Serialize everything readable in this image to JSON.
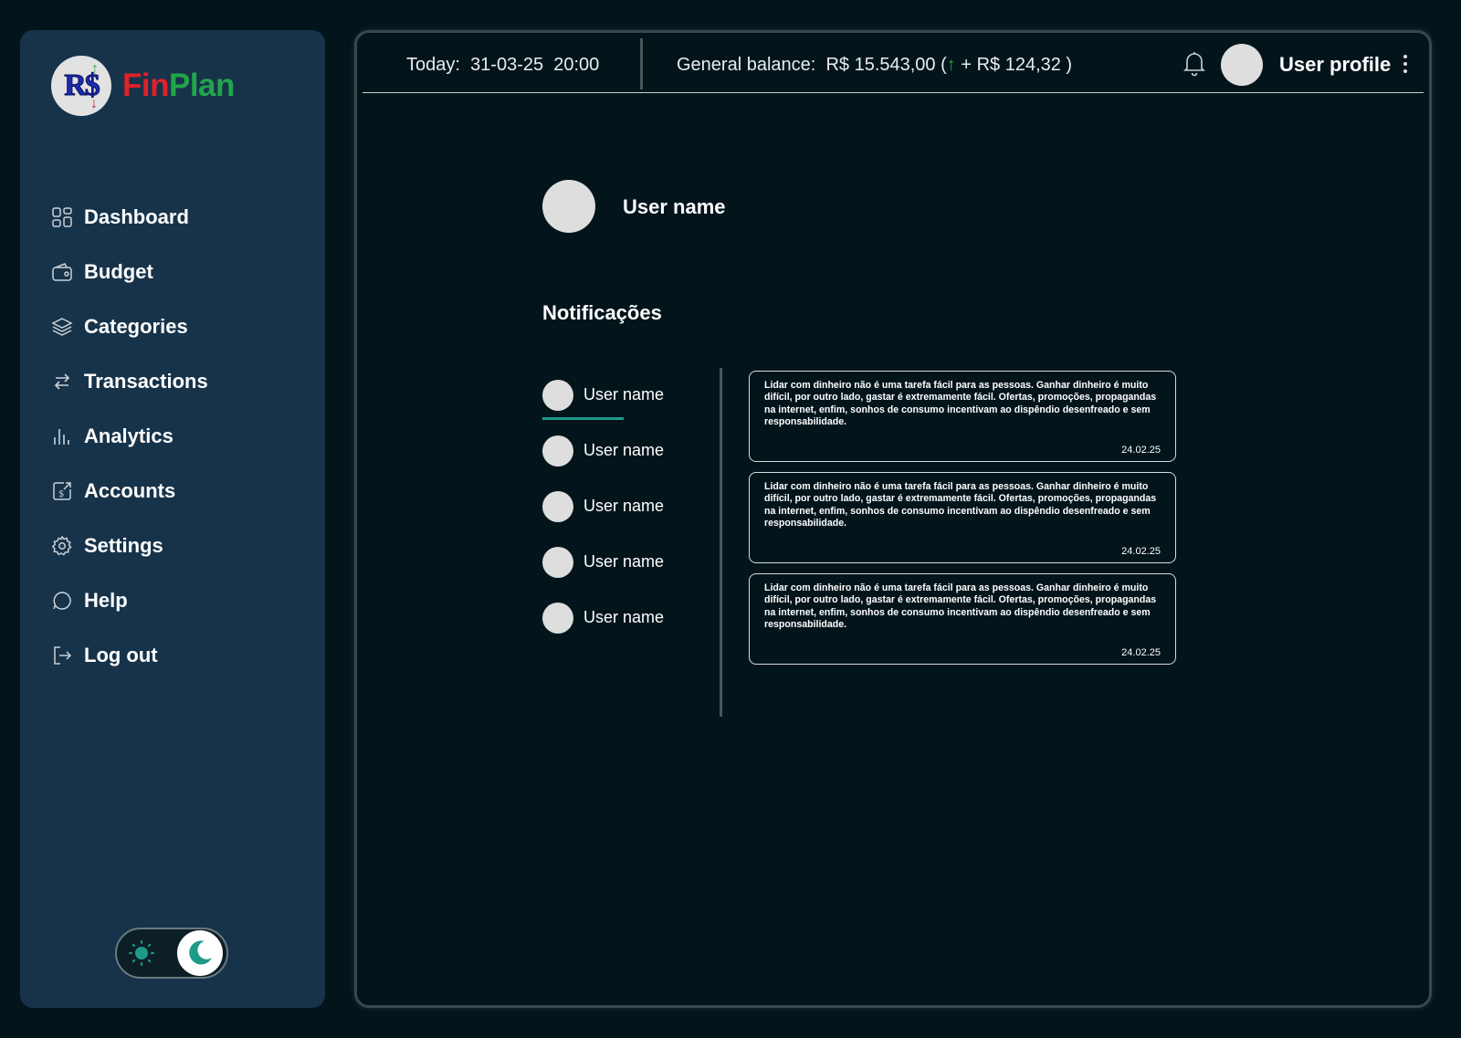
{
  "app": {
    "logo_mark": "R$",
    "brand_first": "Fin",
    "brand_second": "Plan",
    "colors": {
      "brand_red": "#e0212b",
      "brand_green": "#22a54a",
      "accent_teal": "#1e9a8a",
      "sidebar_bg": "#17334a",
      "page_bg": "#03151b"
    }
  },
  "sidebar": {
    "items": [
      {
        "label": "Dashboard",
        "icon": "dashboard-icon"
      },
      {
        "label": "Budget",
        "icon": "wallet-icon"
      },
      {
        "label": "Categories",
        "icon": "layers-icon"
      },
      {
        "label": "Transactions",
        "icon": "transfer-arrows-icon"
      },
      {
        "label": "Analytics",
        "icon": "bar-chart-icon"
      },
      {
        "label": "Accounts",
        "icon": "accounts-icon"
      },
      {
        "label": "Settings",
        "icon": "gear-icon"
      },
      {
        "label": "Help",
        "icon": "chat-bubble-icon"
      },
      {
        "label": "Log out",
        "icon": "logout-icon"
      }
    ],
    "theme": {
      "current": "dark",
      "icons": [
        "sun-icon",
        "moon-icon"
      ]
    }
  },
  "topbar": {
    "today_label": "Today:",
    "date": "31-03-25",
    "time": "20:00",
    "balance_label": "General balance:",
    "balance_value": "R$ 15.543,00",
    "balance_change": "+ R$ 124,32",
    "profile_label": "User profile"
  },
  "main": {
    "user_name": "User name",
    "notifications_title": "Notificações",
    "users": [
      {
        "name": "User name",
        "active": true
      },
      {
        "name": "User name",
        "active": false
      },
      {
        "name": "User name",
        "active": false
      },
      {
        "name": "User name",
        "active": false
      },
      {
        "name": "User name",
        "active": false
      }
    ],
    "messages": [
      {
        "text": "Lidar com dinheiro não é uma tarefa fácil para as pessoas. Ganhar dinheiro é muito difícil, por outro lado, gastar é extremamente fácil. Ofertas, promoções, propagandas na internet, enfim, sonhos de consumo incentivam ao dispêndio desenfreado e sem responsabilidade.",
        "date": "24.02.25"
      },
      {
        "text": "Lidar com dinheiro não é uma tarefa fácil para as pessoas. Ganhar dinheiro é muito difícil, por outro lado, gastar é extremamente fácil. Ofertas, promoções, propagandas na internet, enfim, sonhos de consumo incentivam ao dispêndio desenfreado e sem responsabilidade.",
        "date": "24.02.25"
      },
      {
        "text": "Lidar com dinheiro não é uma tarefa fácil para as pessoas. Ganhar dinheiro é muito difícil, por outro lado, gastar é extremamente fácil. Ofertas, promoções, propagandas na internet, enfim, sonhos de consumo incentivam ao dispêndio desenfreado e sem responsabilidade.",
        "date": "24.02.25"
      }
    ]
  }
}
